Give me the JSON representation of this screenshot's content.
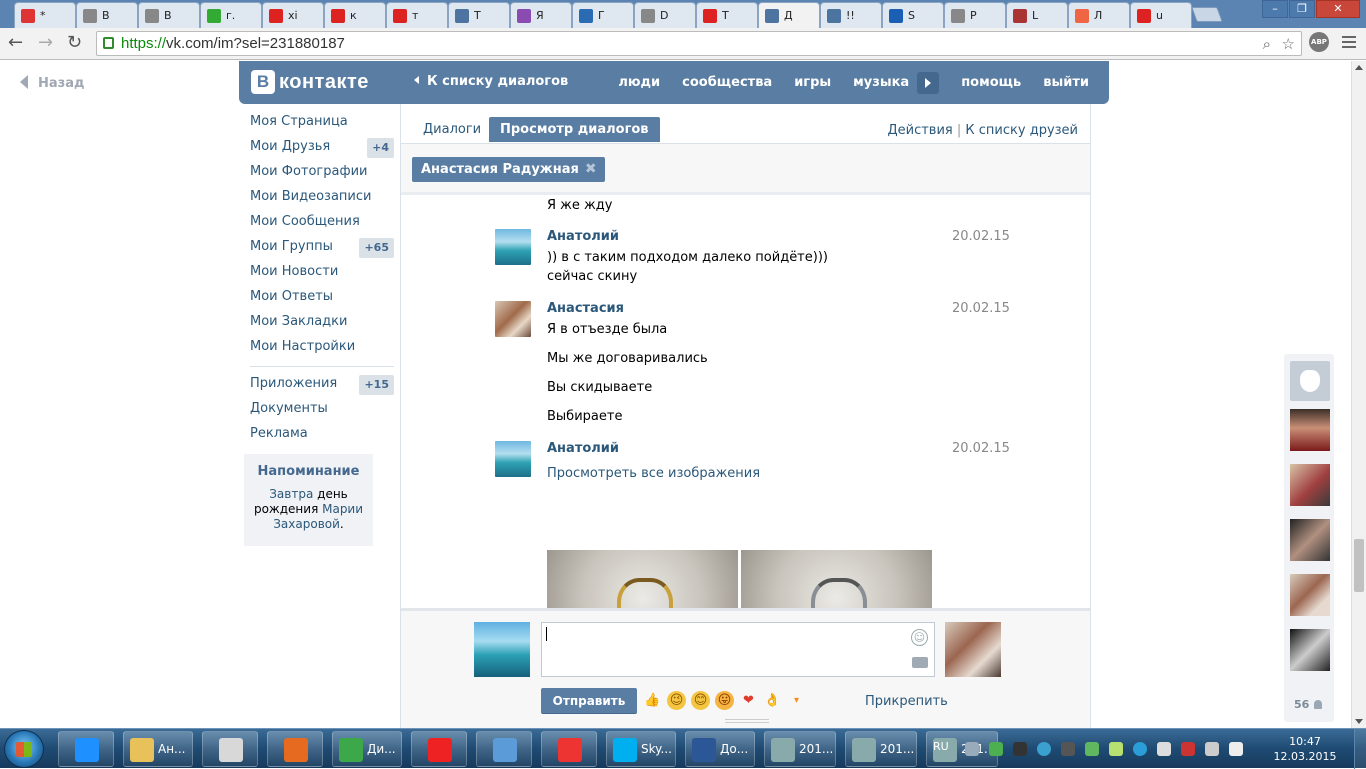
{
  "browser": {
    "tabs": [
      {
        "label": "*",
        "icon": "mail-icon",
        "color": "#d33"
      },
      {
        "label": "В",
        "icon": "doc-icon",
        "color": "#888"
      },
      {
        "label": "В",
        "icon": "doc-icon",
        "color": "#888"
      },
      {
        "label": "г.",
        "icon": "green-circle-icon",
        "color": "#3a3"
      },
      {
        "label": "хі",
        "icon": "yandex-icon",
        "color": "#d22"
      },
      {
        "label": "к",
        "icon": "yandex-icon",
        "color": "#d22"
      },
      {
        "label": "т",
        "icon": "yandex-icon",
        "color": "#d22"
      },
      {
        "label": "Т",
        "icon": "vk-icon",
        "color": "#4d74a1"
      },
      {
        "label": "Я",
        "icon": "chart-icon",
        "color": "#8a4cb0"
      },
      {
        "label": "Г",
        "icon": "emblem-icon",
        "color": "#2a6bb3"
      },
      {
        "label": "D",
        "icon": "doc-icon",
        "color": "#888"
      },
      {
        "label": "Т",
        "icon": "z-icon",
        "color": "#d22"
      },
      {
        "label": "Д",
        "icon": "chat-icon",
        "color": "#4d74a1",
        "active": true
      },
      {
        "label": "!!",
        "icon": "vk-icon",
        "color": "#4d74a1"
      },
      {
        "label": "S",
        "icon": "flag-icon",
        "color": "#1a5fb4"
      },
      {
        "label": "P",
        "icon": "doc-icon",
        "color": "#888"
      },
      {
        "label": "L",
        "icon": "app-icon",
        "color": "#a33"
      },
      {
        "label": "Л",
        "icon": "dots-icon",
        "color": "#e64"
      },
      {
        "label": "u",
        "icon": "yandex-icon",
        "color": "#d22"
      }
    ],
    "url_proto": "https://",
    "url_rest": "vk.com/im?sel=231880187",
    "abp_label": "ABP"
  },
  "vk": {
    "back_label": "Назад",
    "logo_letter": "В",
    "logo_text": "контакте",
    "back_to_dialogs": "К списку диалогов",
    "topnav": [
      "люди",
      "сообщества",
      "игры",
      "музыка",
      "помощь",
      "выйти"
    ],
    "leftmenu": [
      {
        "label": "Моя Страница",
        "count": ""
      },
      {
        "label": "Мои Друзья",
        "count": "+4"
      },
      {
        "label": "Мои Фотографии",
        "count": ""
      },
      {
        "label": "Мои Видеозаписи",
        "count": ""
      },
      {
        "label": "Мои Сообщения",
        "count": ""
      },
      {
        "label": "Мои Группы",
        "count": "+65"
      },
      {
        "label": "Мои Новости",
        "count": ""
      },
      {
        "label": "Мои Ответы",
        "count": ""
      },
      {
        "label": "Мои Закладки",
        "count": ""
      },
      {
        "label": "Мои Настройки",
        "count": ""
      }
    ],
    "leftmenu2": [
      {
        "label": "Приложения",
        "count": "+15"
      },
      {
        "label": "Документы",
        "count": ""
      },
      {
        "label": "Реклама",
        "count": ""
      }
    ],
    "reminder": {
      "title": "Напоминание",
      "t1": "Завтра",
      "t2": "день рождения",
      "t3": "Марии Захаровой",
      "t4": "."
    },
    "tabs": {
      "dialogs": "Диалоги",
      "view": "Просмотр диалогов"
    },
    "actions": {
      "a1": "Действия",
      "sep": "|",
      "a2": "К списку друзей"
    },
    "peer_name": "Анастасия Радужная",
    "messages": {
      "top_line": "Я же жду",
      "m1": {
        "name": "Анатолий",
        "date": "20.02.15",
        "l1": ")) в с таким подходом далеко пойдёте)))",
        "l2": "сейчас скину"
      },
      "m2": {
        "name": "Анастасия",
        "date": "20.02.15",
        "l1": "Я в отъезде была",
        "l2": "Мы же договаривались",
        "l3": "Вы скидываете",
        "l4": "Выбираете"
      },
      "m3": {
        "name": "Анатолий",
        "date": "20.02.15",
        "link": "Просмотреть все изображения"
      }
    },
    "composer": {
      "send": "Отправить",
      "attach": "Прикрепить"
    },
    "friends_count": "56"
  },
  "taskbar": {
    "items": [
      {
        "label": "",
        "icon": "ie-icon"
      },
      {
        "label": "Ан...",
        "icon": "folder-icon"
      },
      {
        "label": "",
        "icon": "paint-icon"
      },
      {
        "label": "",
        "icon": "firefox-icon"
      },
      {
        "label": "Ди...",
        "icon": "chrome-icon"
      },
      {
        "label": "",
        "icon": "yandex-icon"
      },
      {
        "label": "",
        "icon": "speaker-icon"
      },
      {
        "label": "",
        "icon": "yandex-browser-icon"
      },
      {
        "label": "Sky...",
        "icon": "skype-icon"
      },
      {
        "label": "До...",
        "icon": "word-icon"
      },
      {
        "label": "201...",
        "icon": "scanner-icon"
      },
      {
        "label": "201...",
        "icon": "scanner-icon"
      },
      {
        "label": "201...",
        "icon": "scanner-icon"
      }
    ],
    "lang": "RU",
    "time": "10:47",
    "date": "12.03.2015"
  }
}
